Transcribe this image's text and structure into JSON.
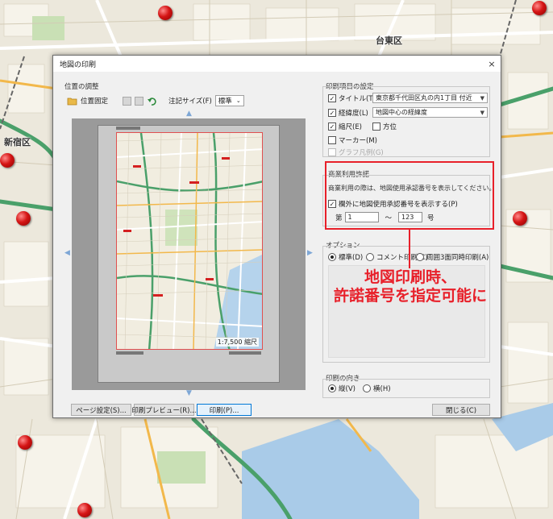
{
  "dialog": {
    "title": "地図の印刷",
    "close": "×"
  },
  "position": {
    "group_label": "位置の調整",
    "fix_label": "位置固定",
    "annotation_size_label": "注記サイズ(F)",
    "annotation_size_value": "標準"
  },
  "preview": {
    "scale": "1:7,500 縮尺"
  },
  "print_items": {
    "group_label": "印刷項目の設定",
    "title_label": "タイトル(T)",
    "title_value": "東京都千代田区丸の内1丁目 付近",
    "latlon_label": "経緯度(L)",
    "latlon_value": "地図中心の経緯度",
    "scale_label": "縮尺(E)",
    "bearing_label": "方位",
    "marker_label": "マーカー(M)",
    "legend_label": "グラフ凡例(G)"
  },
  "commercial": {
    "group_label": "商業利用許諾",
    "description": "商業利用の際は、地図使用承認番号を表示してください。",
    "show_label": "欄外に地図使用承認番号を表示する(P)",
    "prefix": "第",
    "from_value": "1",
    "tilde": "～",
    "to_value": "123",
    "suffix": "号"
  },
  "options": {
    "group_label": "オプション",
    "standard": "標準(D)",
    "comment": "コメント印刷(C)",
    "dual": "周囲3面同時印刷(A)"
  },
  "orientation": {
    "group_label": "印刷の向き",
    "portrait": "縦(V)",
    "landscape": "横(H)"
  },
  "buttons": {
    "page_setup": "ページ設定(S)...",
    "print_preview": "印刷プレビュー(R)...",
    "print": "印刷(P)...",
    "close": "閉じる(C)"
  },
  "callout": {
    "line1": "地図印刷時、",
    "line2": "許諾番号を指定可能に"
  },
  "map_labels": {
    "shinjuku": "新宿区",
    "taito": "台東区"
  },
  "colors": {
    "accent_red": "#e8202a",
    "focus_blue": "#0078d7"
  }
}
